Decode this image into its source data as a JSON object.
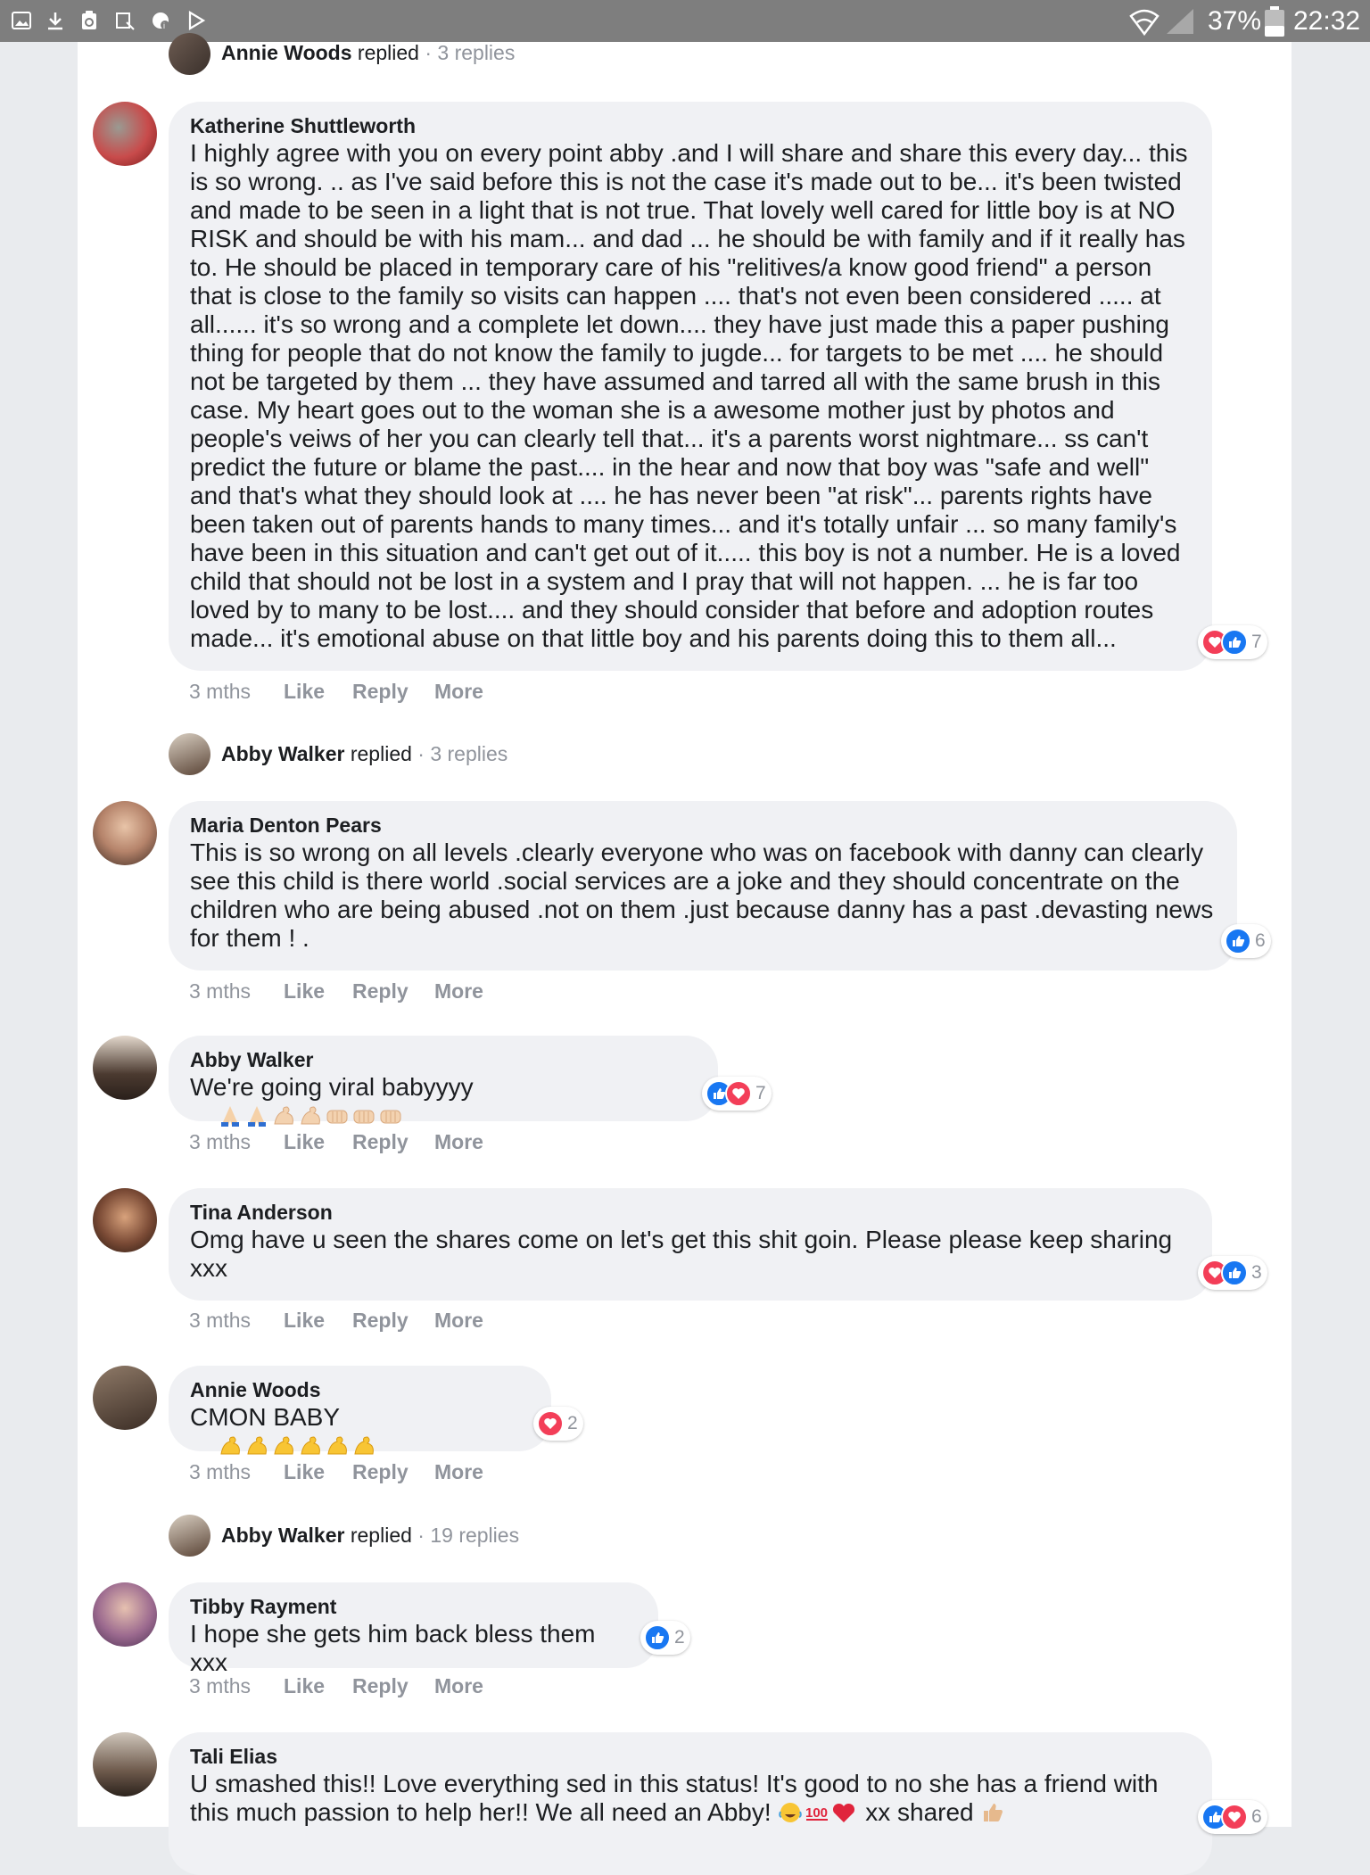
{
  "status_bar": {
    "battery": "37%",
    "time": "22:32"
  },
  "threads": [
    {
      "type": "replied",
      "name": "Annie Woods",
      "verb": "replied",
      "count": "· 3 replies"
    },
    {
      "type": "comment",
      "author": "Katherine Shuttleworth",
      "text": "I highly agree with you on every point abby .and I will share and share this every day... this\nis so wrong. .. as I've said before this is not the case it's made out to be... it's been twisted\nand made to be seen in a light that is not true. That lovely well cared for little boy is at NO\nRISK and should be with his mam... and dad ... he should be with family and if it really has\nto. He should be placed in temporary care of his \"relitives/a know good friend\" a person\nthat is close to the family so visits can happen .... that's not even been considered ..... at\nall...... it's so wrong and a complete let down.... they have just made this a paper pushing\nthing for people that do not know the family to jugde... for targets to be met .... he should\nnot be targeted by them ... they have assumed and tarred all with the same brush in this\ncase. My heart goes out to the woman she is a awesome mother just by photos and\npeople's veiws of her you can clearly tell that... it's a parents worst nightmare... ss can't\npredict the future or blame the past.... in the hear and now that boy was \"safe and well\"\nand that's what they should look at .... he has never been \"at risk\"... parents rights have\nbeen taken out of parents hands to many times... and it's totally unfair ... so many family's\nhave been in this situation and can't get out of it..... this boy is not a number. He is a loved\nchild that should not be lost in a system and I pray that will not happen. ... he is far too\nloved by to many to be lost.... and they should consider that before and adoption routes\nmade... it's emotional abuse on that little boy and his parents doing this to them all...",
      "reaction_count": "7",
      "time": "3 mths"
    },
    {
      "type": "replied",
      "name": "Abby Walker",
      "verb": "replied",
      "count": "· 3 replies"
    },
    {
      "type": "comment",
      "author": "Maria Denton Pears",
      "text": "This is so wrong on all levels .clearly everyone who was on facebook with danny can clearly\nsee this child is there world .social services are a joke and they should concentrate on the\nchildren who are being abused .not on them .just because danny has a past .devasting news\nfor them ! .",
      "reaction_count": "6",
      "time": "3 mths"
    },
    {
      "type": "comment",
      "author": "Abby Walker",
      "text": "We're going viral babyyyy",
      "reaction_count": "7",
      "time": "3 mths"
    },
    {
      "type": "comment",
      "author": "Tina Anderson",
      "text": "Omg have u seen the shares come on let's get this shit goin. Please please keep sharing\nxxx",
      "reaction_count": "3",
      "time": "3 mths"
    },
    {
      "type": "comment",
      "author": "Annie Woods",
      "text": "CMON BABY",
      "reaction_count": "2",
      "time": "3 mths"
    },
    {
      "type": "replied",
      "name": "Abby Walker",
      "verb": "replied",
      "count": "· 19 replies"
    },
    {
      "type": "comment",
      "author": "Tibby Rayment",
      "text": "I hope she gets him back bless them xxx",
      "reaction_count": "2",
      "time": "3 mths"
    },
    {
      "type": "comment",
      "author": "Tali Elias",
      "text": "U smashed this!! Love everything sed in this status! It's good to no she has a friend with\nthis much passion to help her!! We all need an Abby!",
      "text_tail": "xx shared",
      "reaction_count": "6"
    }
  ],
  "actions": {
    "like": "Like",
    "reply": "Reply",
    "more": "More"
  }
}
